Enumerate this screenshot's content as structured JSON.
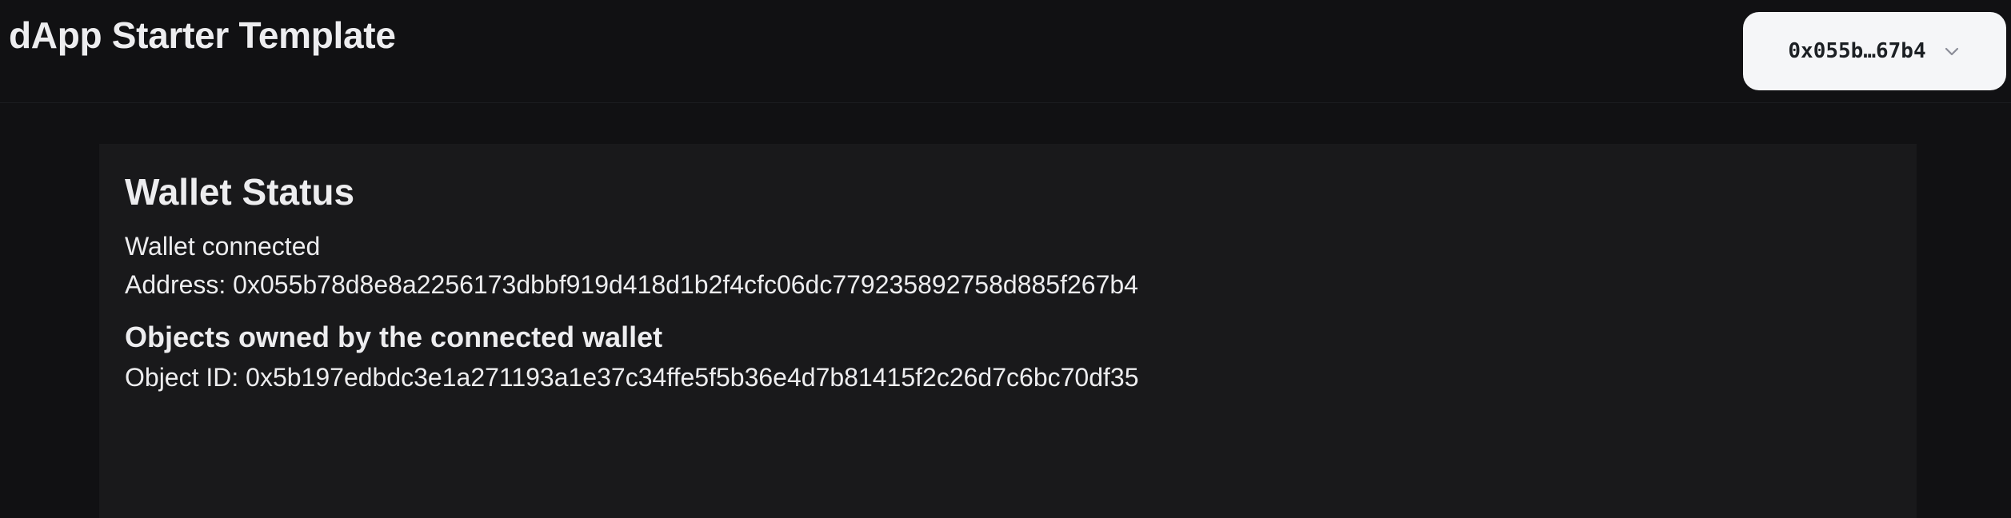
{
  "header": {
    "title": "dApp Starter Template",
    "wallet_button_label": "0x055b…67b4"
  },
  "wallet_status": {
    "title": "Wallet Status",
    "connection_status": "Wallet connected",
    "address_label": "Address:",
    "address_value": "0x055b78d8e8a2256173dbbf919d418d1b2f4cfc06dc779235892758d885f267b4",
    "address_line": "Address: 0x055b78d8e8a2256173dbbf919d418d1b2f4cfc06dc779235892758d885f267b4",
    "objects_heading": "Objects owned by the connected wallet",
    "objects": [
      {
        "label": "Object ID:",
        "id": "0x5b197edbdc3e1a271193a1e37c34ffe5f5b36e4d7b81415f2c26d7c6bc70df35",
        "line": "Object ID: 0x5b197edbdc3e1a271193a1e37c34ffe5f5b36e4d7b81415f2c26d7c6bc70df35"
      }
    ]
  },
  "icons": {
    "wallet_dropdown": "chevron-down-icon"
  },
  "colors": {
    "background": "#111113",
    "card": "#19191b",
    "text": "#ededef",
    "wallet_button_bg": "#f5f6f8",
    "wallet_button_text": "#1c2024"
  }
}
